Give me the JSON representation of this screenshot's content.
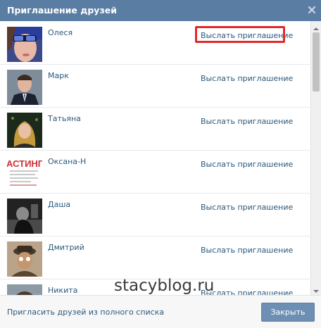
{
  "dialog": {
    "title": "Приглашение друзей",
    "close_icon": "close-icon"
  },
  "friends": [
    {
      "name": "Олеся",
      "invite_label": "Выслать приглашение",
      "highlighted": true
    },
    {
      "name": "Марк",
      "invite_label": "Выслать приглашение",
      "highlighted": false
    },
    {
      "name": "Татьяна",
      "invite_label": "Выслать приглашение",
      "highlighted": false
    },
    {
      "name": "Оксана-Н",
      "invite_label": "Выслать приглашение",
      "highlighted": false
    },
    {
      "name": "Даша",
      "invite_label": "Выслать приглашение",
      "highlighted": false
    },
    {
      "name": "Дмитрий",
      "invite_label": "Выслать приглашение",
      "highlighted": false
    },
    {
      "name": "Никита",
      "invite_label": "Выслать приглашение",
      "highlighted": false
    }
  ],
  "avatar_4_text": "АСТИНГ",
  "watermark": "stacyblog.ru",
  "footer": {
    "link_label": "Пригласить друзей из полного списка",
    "close_button_label": "Закрыть"
  },
  "colors": {
    "titlebar": "#597da3",
    "link": "#2b587a",
    "button": "#6d8fb3",
    "highlight": "#e02a2a"
  }
}
